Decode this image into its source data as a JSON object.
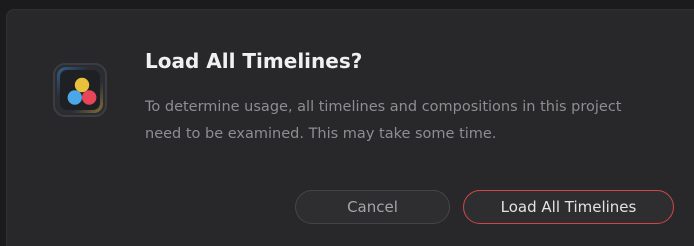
{
  "dialog": {
    "app_icon": "davinci-resolve-logo-icon",
    "title": "Load All Timelines?",
    "message": "To determine usage, all timelines and compositions in this project need to be examined. This may take some time.",
    "buttons": {
      "cancel_label": "Cancel",
      "confirm_label": "Load All Timelines"
    }
  },
  "colors": {
    "background": "#28282b",
    "accent_border": "#d04747",
    "title_text": "#f0f0f0",
    "body_text": "#8e8e92"
  }
}
